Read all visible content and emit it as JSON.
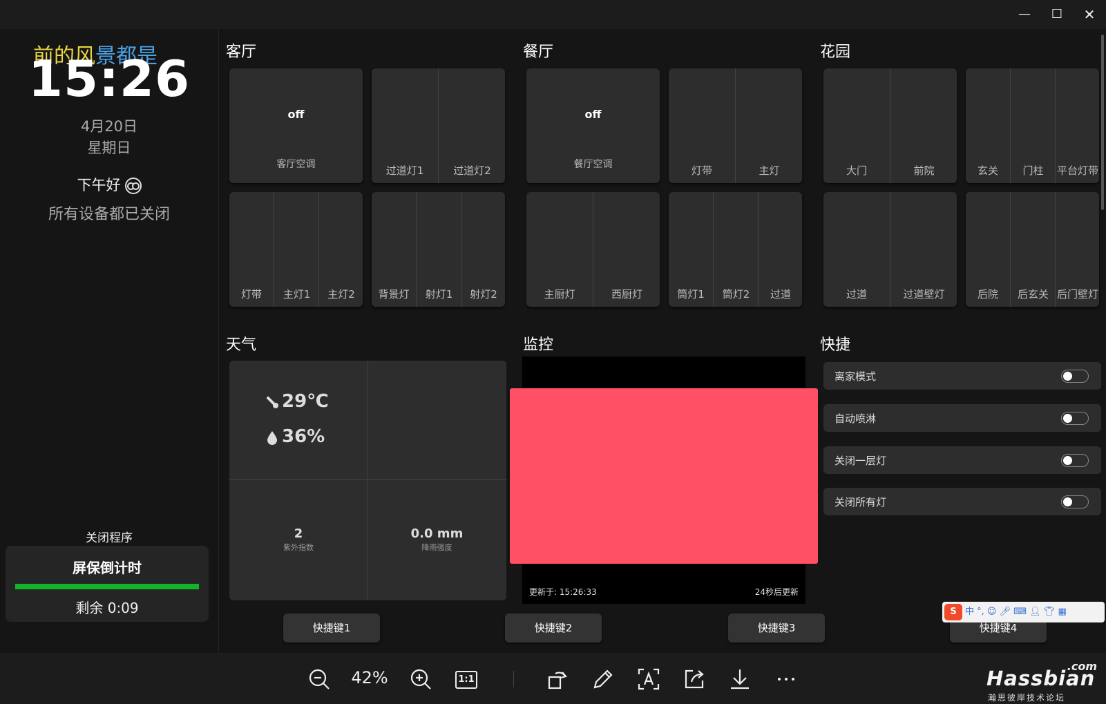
{
  "window": {
    "minimize": "—",
    "maximize": "☐",
    "close": "✕"
  },
  "sidebar": {
    "ticker": {
      "part1": "前的风",
      "part2": "景都是"
    },
    "time": "15:26",
    "date": "4月20日",
    "weekday": "星期日",
    "greeting": "下午好",
    "status": "所有设备都已关闭",
    "exit_label": "关闭程序",
    "screensaver": {
      "title": "屏保倒计时",
      "progress": 1.0,
      "remaining": "剩余 0:09",
      "bar_color": "#12b528"
    }
  },
  "rooms": [
    {
      "name": "客厅",
      "cards": [
        {
          "type": "ac",
          "state": "off",
          "label": "客厅空调"
        },
        {
          "type": "lights",
          "labels": [
            "过道灯1",
            "过道灯2"
          ]
        },
        {
          "type": "lights",
          "labels": [
            "灯带",
            "主灯1",
            "主灯2"
          ]
        },
        {
          "type": "lights",
          "labels": [
            "背景灯",
            "射灯1",
            "射灯2"
          ]
        }
      ]
    },
    {
      "name": "餐厅",
      "cards": [
        {
          "type": "ac",
          "state": "off",
          "label": "餐厅空调"
        },
        {
          "type": "lights",
          "labels": [
            "灯带",
            "主灯"
          ]
        },
        {
          "type": "lights",
          "labels": [
            "主厨灯",
            "西厨灯"
          ]
        },
        {
          "type": "lights",
          "labels": [
            "筒灯1",
            "筒灯2",
            "过道"
          ]
        }
      ]
    },
    {
      "name": "花园",
      "cards": [
        {
          "type": "lights",
          "labels": [
            "大门",
            "前院"
          ]
        },
        {
          "type": "lights",
          "labels": [
            "玄关",
            "门柱",
            "平台灯带"
          ]
        },
        {
          "type": "lights",
          "labels": [
            "过道",
            "过道壁灯"
          ]
        },
        {
          "type": "lights",
          "labels": [
            "后院",
            "后玄关",
            "后门壁灯"
          ]
        }
      ]
    }
  ],
  "weather": {
    "title": "天气",
    "temperature": "29℃",
    "humidity": "36%",
    "uv_value": "2",
    "uv_label": "紫外指数",
    "rain_value": "0.0 mm",
    "rain_label": "降雨强度"
  },
  "camera": {
    "title": "监控",
    "updated": "更新于: 15:26:33",
    "next_update": "24秒后更新",
    "image_color": "#ff5065"
  },
  "quick": {
    "title": "快捷",
    "items": [
      {
        "label": "离家模式",
        "on": false
      },
      {
        "label": "自动喷淋",
        "on": false
      },
      {
        "label": "关闭一层灯",
        "on": false
      },
      {
        "label": "关闭所有灯",
        "on": false
      }
    ]
  },
  "shortcuts": [
    "快捷键1",
    "快捷键2",
    "快捷键3",
    "快捷键4"
  ],
  "ime": {
    "logo": "S",
    "mode": "中"
  },
  "toolbar": {
    "zoom": "42%",
    "fit_label": "1:1",
    "icons": [
      "zoom-out-icon",
      "zoom-in-icon",
      "actual-size-icon",
      "rotate-icon",
      "edit-icon",
      "text-recognition-icon",
      "share-icon",
      "download-icon",
      "more-icon"
    ]
  },
  "brand": {
    "com": ".com",
    "name": "Hassbian",
    "sub": "瀚思彼岸技术论坛"
  }
}
